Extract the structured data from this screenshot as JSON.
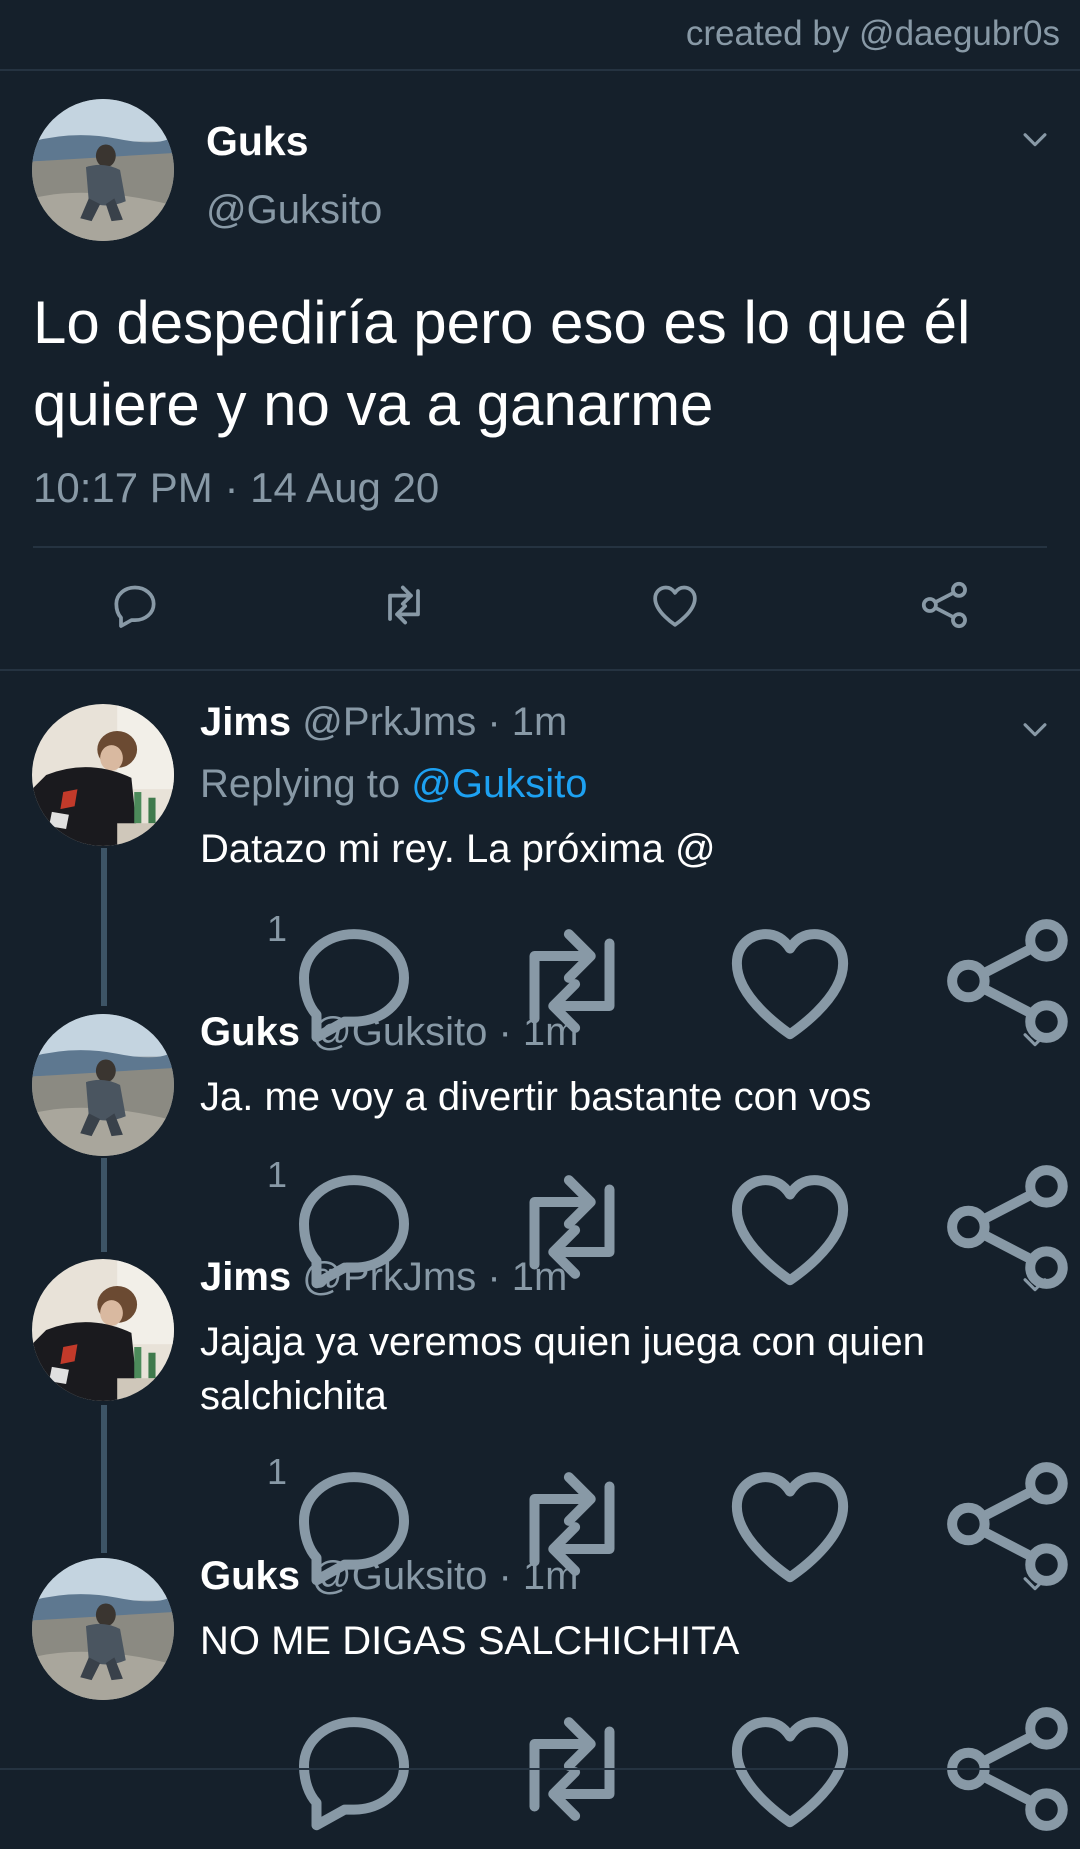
{
  "credit": "created by @daegubr0s",
  "main_tweet": {
    "name": "Guks",
    "handle": "@Guksito",
    "text": "Lo despediría pero eso es lo que él quiere y no va a ganarme",
    "timestamp": "10:17 PM · 14 Aug 20",
    "actions": [
      "reply-icon",
      "retweet-icon",
      "like-icon",
      "share-icon"
    ]
  },
  "replies": [
    {
      "name": "Jims",
      "meta": "@PrkJms · 1m",
      "replying_label": "Replying to ",
      "replying_handle": "@Guksito",
      "text": "Datazo mi rey. La próxima @",
      "reply_count": "1"
    },
    {
      "name": "Guks",
      "meta": "@Guksito · 1m",
      "text": "Ja. me voy a divertir bastante con vos",
      "reply_count": "1"
    },
    {
      "name": "Jims",
      "meta": "@PrkJms · 1m",
      "text": "Jajaja ya veremos quien juega con quien salchichita",
      "reply_count": "1"
    },
    {
      "name": "Guks",
      "meta": "@Guksito · 1m",
      "text": "NO ME DIGAS SALCHICHITA",
      "reply_count": ""
    }
  ],
  "colors": {
    "background": "#15202b",
    "secondary_text": "#8899a6",
    "link": "#1da1f2",
    "divider": "#253341"
  }
}
